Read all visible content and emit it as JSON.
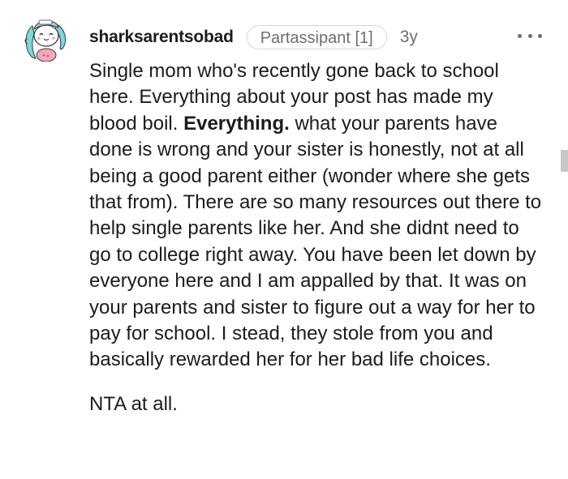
{
  "comment": {
    "username": "sharksarentsobad",
    "flair": "Partassipant [1]",
    "age": "3y",
    "more_icon": "more-horizontal-icon",
    "paragraph_1": {
      "before_bold": "Single mom who's recently gone back to school here. Everything about your post has made my blood boil. ",
      "bold": "Everything.",
      "after_bold": " what your parents have done is wrong and your sister is honestly, not at all being a good parent either (wonder where she gets that from). There are so many resources out there to help single parents like her. And she didnt need to go to college right away. You have been let down by everyone here and I am appalled by that. It was on your parents and sister to figure out a way for her to pay for school. I stead, they stole from you and basically rewarded her for her bad life choices."
    },
    "paragraph_2": "NTA at all."
  },
  "colors": {
    "text": "#1c1c1c",
    "meta": "#6b6f72",
    "flair_border": "#d4d7d9",
    "avatar_hair": "#7fd6dc",
    "avatar_shirt": "#f4a7b9"
  }
}
